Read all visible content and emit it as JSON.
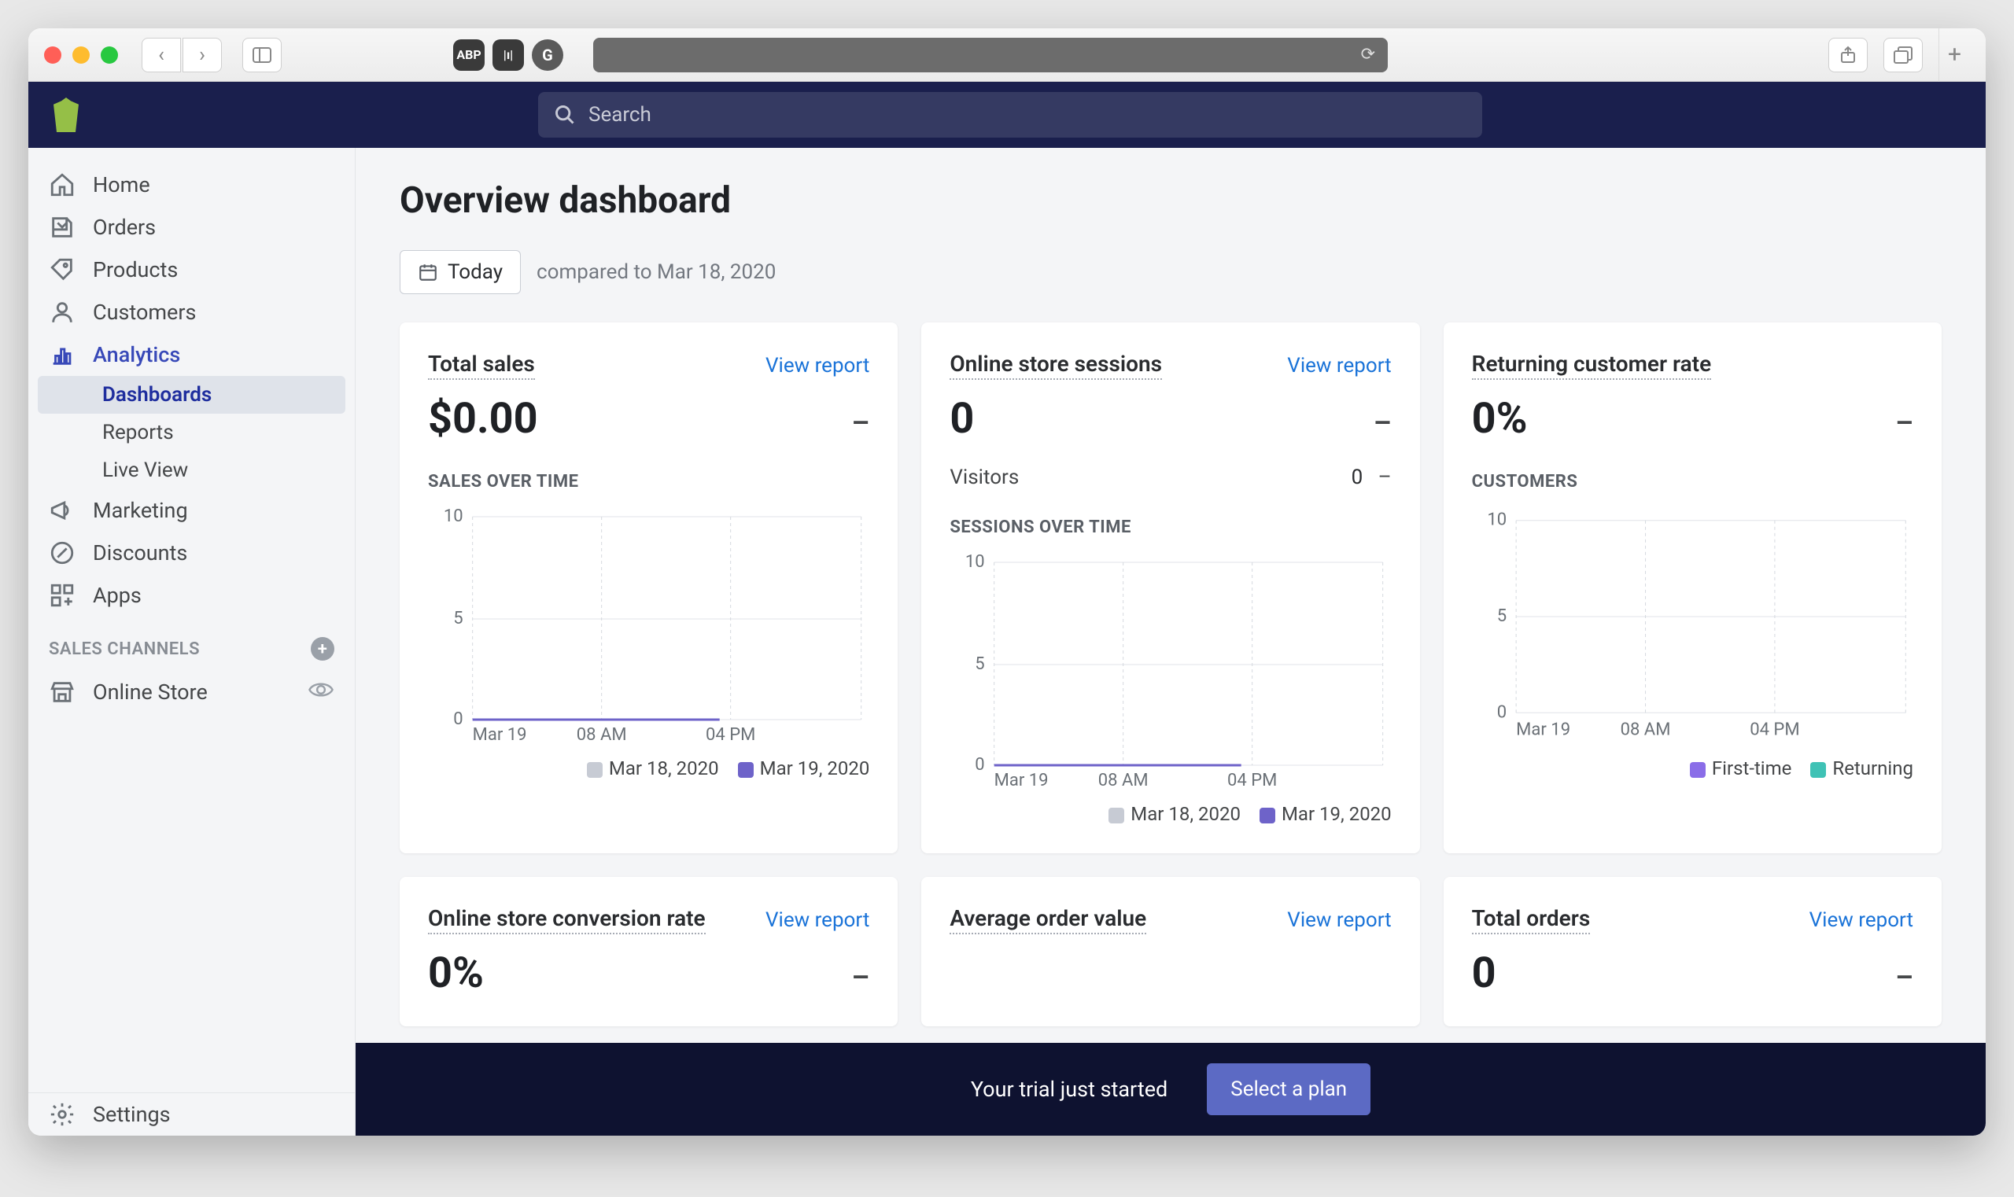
{
  "search": {
    "placeholder": "Search"
  },
  "sidebar": {
    "items": [
      "Home",
      "Orders",
      "Products",
      "Customers",
      "Analytics",
      "Marketing",
      "Discounts",
      "Apps"
    ],
    "analytics_sub": [
      "Dashboards",
      "Reports",
      "Live View"
    ],
    "channels_header": "SALES CHANNELS",
    "channel": "Online Store",
    "settings": "Settings"
  },
  "page": {
    "title": "Overview dashboard",
    "date_btn": "Today",
    "compared": "compared to Mar 18, 2020"
  },
  "view_report": "View report",
  "cards": {
    "total_sales": {
      "label": "Total sales",
      "value": "$0.00",
      "delta": "–",
      "chart_title": "SALES OVER TIME"
    },
    "sessions": {
      "label": "Online store sessions",
      "value": "0",
      "delta": "–",
      "visitors_label": "Visitors",
      "visitors": "0",
      "visitors_delta": "–",
      "chart_title": "SESSIONS OVER TIME"
    },
    "returning": {
      "label": "Returning customer rate",
      "value": "0%",
      "delta": "–",
      "chart_title": "CUSTOMERS",
      "legend_a": "First-time",
      "legend_b": "Returning"
    },
    "conversion": {
      "label": "Online store conversion rate",
      "value": "0%",
      "delta": "–"
    },
    "aov": {
      "label": "Average order value"
    },
    "total_orders": {
      "label": "Total orders",
      "value": "0",
      "delta": "–"
    }
  },
  "series_legend": {
    "a": "Mar 18, 2020",
    "b": "Mar 19, 2020"
  },
  "trial": {
    "text": "Your trial just started",
    "cta": "Select a plan"
  },
  "chart_data": [
    {
      "type": "line",
      "title": "SALES OVER TIME",
      "x": [
        "Mar 19",
        "08 AM",
        "04 PM"
      ],
      "ylim": [
        0,
        10
      ],
      "yticks": [
        0,
        5,
        10
      ],
      "series": [
        {
          "name": "Mar 18, 2020",
          "values": [
            0,
            0,
            0
          ]
        },
        {
          "name": "Mar 19, 2020",
          "values": [
            0,
            0,
            0
          ]
        }
      ]
    },
    {
      "type": "line",
      "title": "SESSIONS OVER TIME",
      "x": [
        "Mar 19",
        "08 AM",
        "04 PM"
      ],
      "ylim": [
        0,
        10
      ],
      "yticks": [
        0,
        5,
        10
      ],
      "series": [
        {
          "name": "Mar 18, 2020",
          "values": [
            0,
            0,
            0
          ]
        },
        {
          "name": "Mar 19, 2020",
          "values": [
            0,
            0,
            0
          ]
        }
      ]
    },
    {
      "type": "line",
      "title": "CUSTOMERS",
      "x": [
        "Mar 19",
        "08 AM",
        "04 PM"
      ],
      "ylim": [
        0,
        10
      ],
      "yticks": [
        0,
        5,
        10
      ],
      "series": [
        {
          "name": "First-time",
          "values": [
            0,
            0,
            0
          ]
        },
        {
          "name": "Returning",
          "values": [
            0,
            0,
            0
          ]
        }
      ]
    }
  ]
}
